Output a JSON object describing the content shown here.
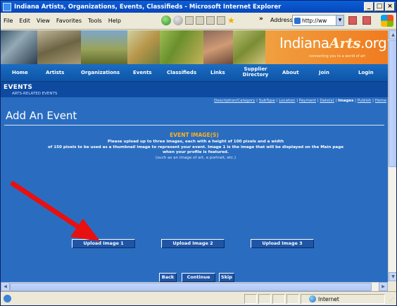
{
  "window": {
    "title": "Indiana Artists, Organizations, Events, Classifieds - Microsoft Internet Explorer",
    "controls": [
      "_",
      "□",
      "×"
    ]
  },
  "menu": [
    "File",
    "Edit",
    "View",
    "Favorites",
    "Tools",
    "Help"
  ],
  "toolbar": {
    "chevron": "»",
    "address_label": "Address",
    "address_value": "http://ww"
  },
  "site": {
    "logo_main": "Indiana",
    "logo_arts": "Arts",
    "logo_tld": ".org",
    "logo_tagline": "connecting you to a world of art",
    "nav": [
      "Home",
      "Artists",
      "Organizations",
      "Events",
      "Classifieds",
      "Links",
      "Supplier\nDirectory",
      "About",
      "Join",
      "Login"
    ],
    "section": "EVENTS",
    "subsection": "ARTS-RELATED EVENTS"
  },
  "steps": {
    "items": [
      "Description/Category",
      "SubType",
      "Location",
      "Payment",
      "Date(s)",
      "Images",
      "Publish",
      "Home"
    ],
    "current": "Images"
  },
  "page": {
    "title": "Add An Event",
    "section_title": "EVENT IMAGE(S)",
    "instruction_line1": "Please upload up to three images, each with a height of 100 pixels and a width",
    "instruction_line2": "of 150 pixels to be used as a thumbnail image to represent your event. Image 1 is the image that will be displayed on the Main page",
    "instruction_line3": "when your profile is featured.",
    "instruction_note": "(such as an image of art, a portrait, etc.)"
  },
  "buttons": {
    "upload1": "Upload Image 1",
    "upload2": "Upload Image 2",
    "upload3": "Upload Image 3",
    "back": "Back",
    "continue": "Continue",
    "skip": "Skip"
  },
  "status": {
    "zone": "Internet"
  },
  "colors": {
    "page_bg": "#2a6dc0",
    "accent_orange": "#ffb11a",
    "arrow_red": "#e81010"
  }
}
